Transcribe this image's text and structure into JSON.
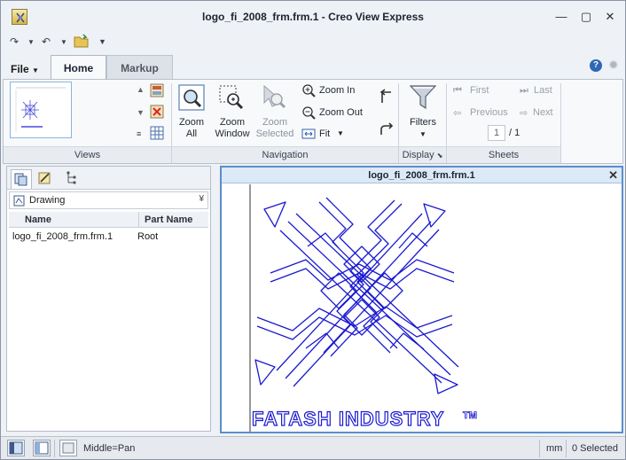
{
  "window": {
    "title": "logo_fi_2008_frm.frm.1 - Creo View Express"
  },
  "window_controls": {
    "minimize": "—",
    "maximize": "▢",
    "close": "✕"
  },
  "ribbon_tabs": {
    "file": "File",
    "home": "Home",
    "markup": "Markup"
  },
  "ribbon": {
    "groups": {
      "views": "Views",
      "navigation": "Navigation",
      "display": "Display",
      "sheets": "Sheets"
    },
    "zoom_all": [
      "Zoom",
      "All"
    ],
    "zoom_window": [
      "Zoom",
      "Window"
    ],
    "zoom_selected": [
      "Zoom",
      "Selected"
    ],
    "zoom_in": "Zoom In",
    "zoom_out": "Zoom Out",
    "fit": "Fit",
    "filters": "Filters",
    "first": "First",
    "last": "Last",
    "previous": "Previous",
    "next": "Next",
    "page_input": "1",
    "page_total": "/ 1"
  },
  "left_panel": {
    "dropdown": "Drawing",
    "columns": {
      "name": "Name",
      "part_name": "Part Name"
    },
    "rows": [
      {
        "name": "logo_fi_2008_frm.frm.1",
        "part_name": "Root"
      }
    ]
  },
  "viewer": {
    "title": "logo_fi_2008_frm.frm.1",
    "logo_text": "FATASH INDUSTRY",
    "trademark": "TM"
  },
  "status": {
    "mouse_hint": "Middle=Pan",
    "units": "mm",
    "selected": "0 Selected"
  },
  "colors": {
    "accent": "#5b8ecb",
    "drawing": "#1a1ad0"
  }
}
